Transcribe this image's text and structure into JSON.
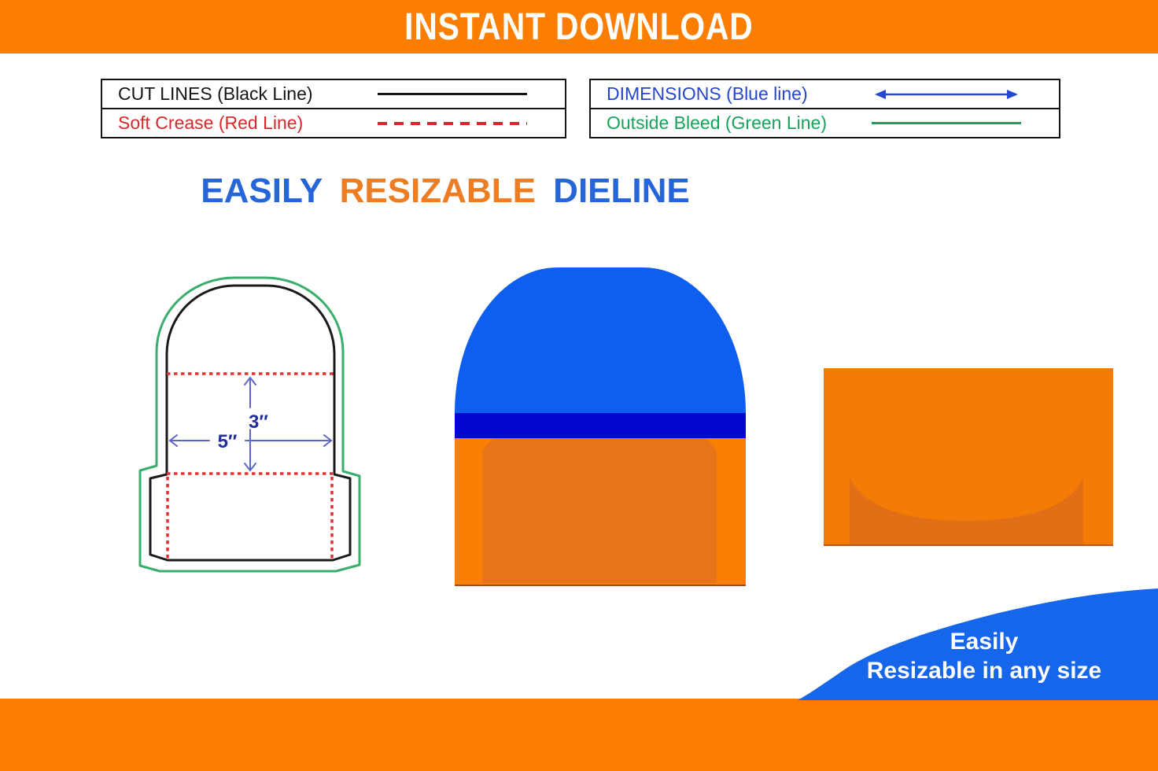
{
  "banner": {
    "top_text": "INSTANT DOWNLOAD"
  },
  "legend": {
    "cut_lines_label": "CUT LINES (Black Line)",
    "soft_crease_label": "Soft Crease (Red Line)",
    "dimensions_label": "DIMENSIONS (Blue line)",
    "outside_bleed_label": "Outside Bleed (Green Line)"
  },
  "headline": {
    "word_1": "EASILY",
    "word_2": "RESIZABLE",
    "word_3": "DIELINE"
  },
  "dieline": {
    "height_dimension": "3″",
    "width_dimension": "5″"
  },
  "badge": {
    "line_1": "Easily",
    "line_2": "Resizable in any size"
  },
  "colors": {
    "banner_orange": "#fb7e00",
    "headline_blue": "#2565d8",
    "headline_orange": "#ed7d23",
    "cut_line_black": "#1a1a1a",
    "soft_crease_red": "#d32b2b",
    "dimension_blue": "#2547d0",
    "outside_bleed_green": "#18a35c",
    "flap_blue": "#0e5ff0",
    "flap_edge_dark_blue": "#0505d2",
    "envelope_body_orange": "#f98004",
    "envelope_pocket_orange": "#e7741a",
    "back_panel_orange": "#f47b06",
    "back_flap_shadow_orange": "#e06f15",
    "badge_blue": "#1666ec"
  }
}
